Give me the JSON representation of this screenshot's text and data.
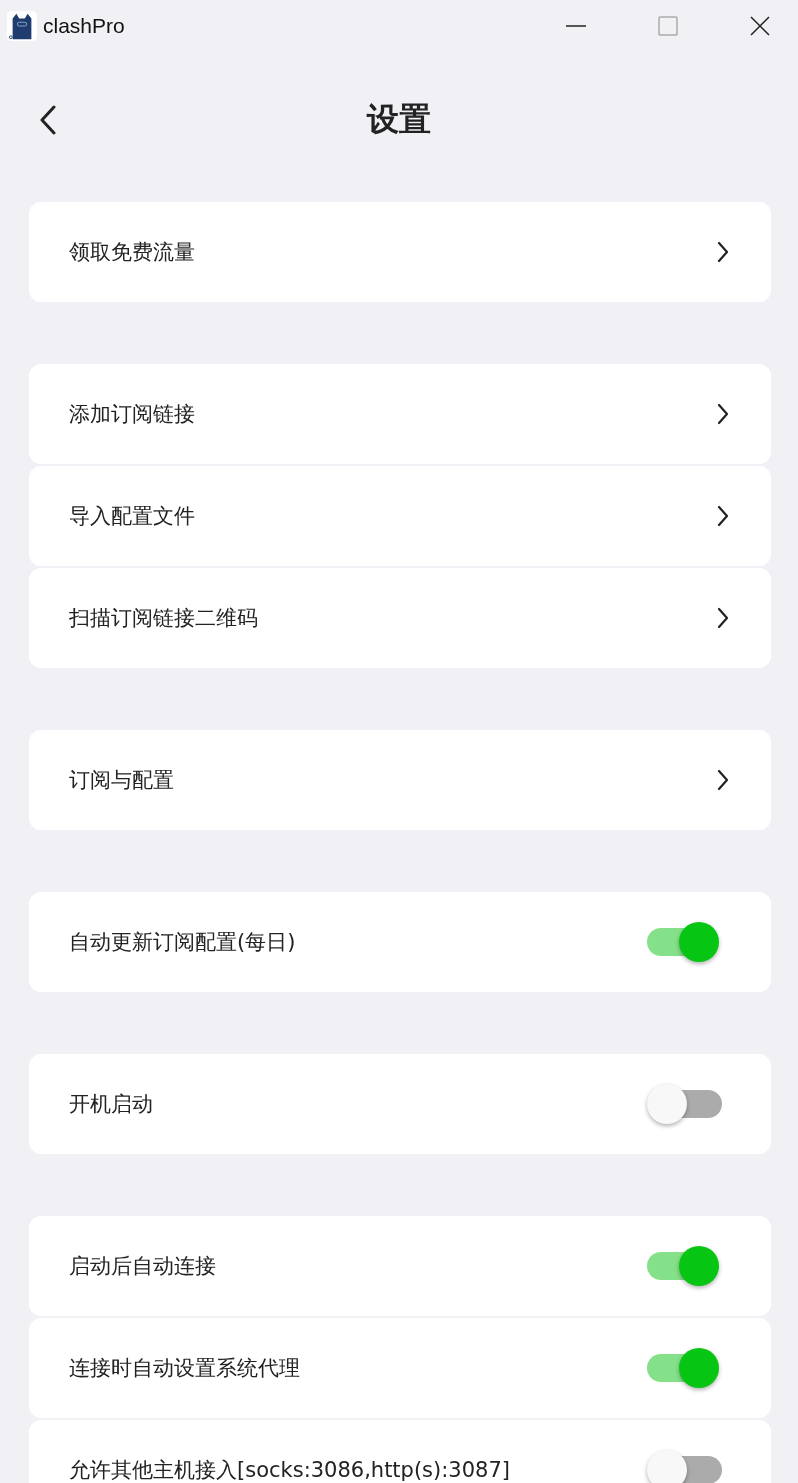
{
  "window": {
    "title": "clashPro"
  },
  "header": {
    "title": "设置"
  },
  "groups": [
    {
      "items": [
        {
          "kind": "link",
          "label": "领取免费流量"
        }
      ]
    },
    {
      "items": [
        {
          "kind": "link",
          "label": "添加订阅链接"
        },
        {
          "kind": "link",
          "label": "导入配置文件"
        },
        {
          "kind": "link",
          "label": "扫描订阅链接二维码"
        }
      ]
    },
    {
      "items": [
        {
          "kind": "link",
          "label": "订阅与配置"
        }
      ]
    },
    {
      "items": [
        {
          "kind": "toggle",
          "label": "自动更新订阅配置(每日)",
          "on": true
        }
      ]
    },
    {
      "items": [
        {
          "kind": "toggle",
          "label": "开机启动",
          "on": false
        }
      ]
    },
    {
      "items": [
        {
          "kind": "toggle",
          "label": "启动后自动连接",
          "on": true
        },
        {
          "kind": "toggle",
          "label": "连接时自动设置系统代理",
          "on": true
        },
        {
          "kind": "toggle",
          "label": "允许其他主机接入[socks:3086,http(s):3087]",
          "on": false
        }
      ]
    }
  ]
}
